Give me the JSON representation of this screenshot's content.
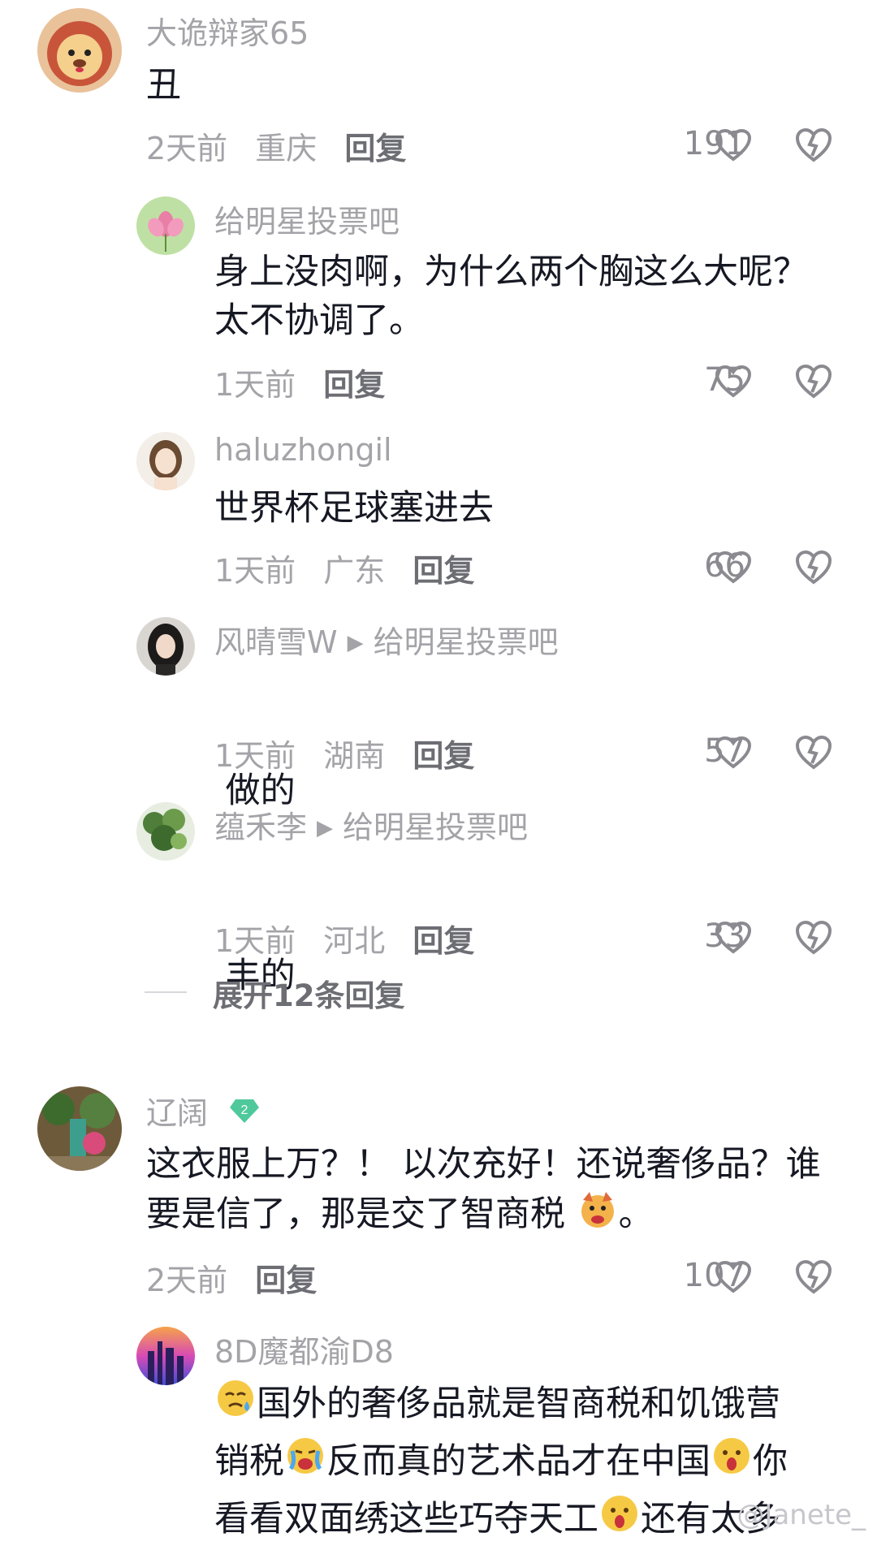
{
  "comments": [
    {
      "username": "大诡辩家65",
      "text": "丑",
      "time": "2天前",
      "location": "重庆",
      "reply": "回复",
      "likes": "191",
      "replies": [
        {
          "username": "给明星投票吧",
          "reply_to": "",
          "text_lines": [
            "身上没肉啊，为什么两个胸这么大呢？",
            "太不协调了。"
          ],
          "time": "1天前",
          "location": "",
          "reply": "回复",
          "likes": "75"
        },
        {
          "username": "haluzhongil",
          "reply_to": "",
          "text_lines": [
            "世界杯足球塞进去"
          ],
          "time": "1天前",
          "location": "广东",
          "reply": "回复",
          "likes": "66"
        },
        {
          "username": "风晴雪W",
          "reply_to": "给明星投票吧",
          "text_lines": [
            " 做的"
          ],
          "time": "1天前",
          "location": "湖南",
          "reply": "回复",
          "likes": "57"
        },
        {
          "username": "蕴禾李",
          "reply_to": "给明星投票吧",
          "text_lines": [
            " 丰的"
          ],
          "time": "1天前",
          "location": "河北",
          "reply": "回复",
          "likes": "33"
        }
      ],
      "expand_label": "展开12条回复"
    },
    {
      "username": "辽阔",
      "level_badge": "2",
      "text_line1": "这衣服上万？！ 以次充好！还说奢侈品？谁",
      "text_line2a": "要是信了，那是交了智商税",
      "text_line2b": "。",
      "time": "2天前",
      "reply": "回复",
      "likes": "107",
      "reply_item": {
        "username": "8D魔都渝D8",
        "line1": "国外的奢侈品就是智商税和饥饿营",
        "line2a": "销税",
        "line2b": "反而真的艺术品才在中国",
        "line2c": "你",
        "line3a": "看看双面绣这些巧夺天工",
        "line3b": "还有太多"
      }
    }
  ],
  "watermark": "@Janete_",
  "icons": [
    "lion-avatar",
    "heart-icon",
    "dislike-heart-icon",
    "play-arrow-icon",
    "level-badge-icon",
    "sweat-emoji",
    "crying-emoji",
    "surprised-emoji",
    "cat-emoji"
  ],
  "colors": {
    "text": "#161823",
    "muted": "#a3a3a8",
    "badge": "#4fc99c"
  }
}
